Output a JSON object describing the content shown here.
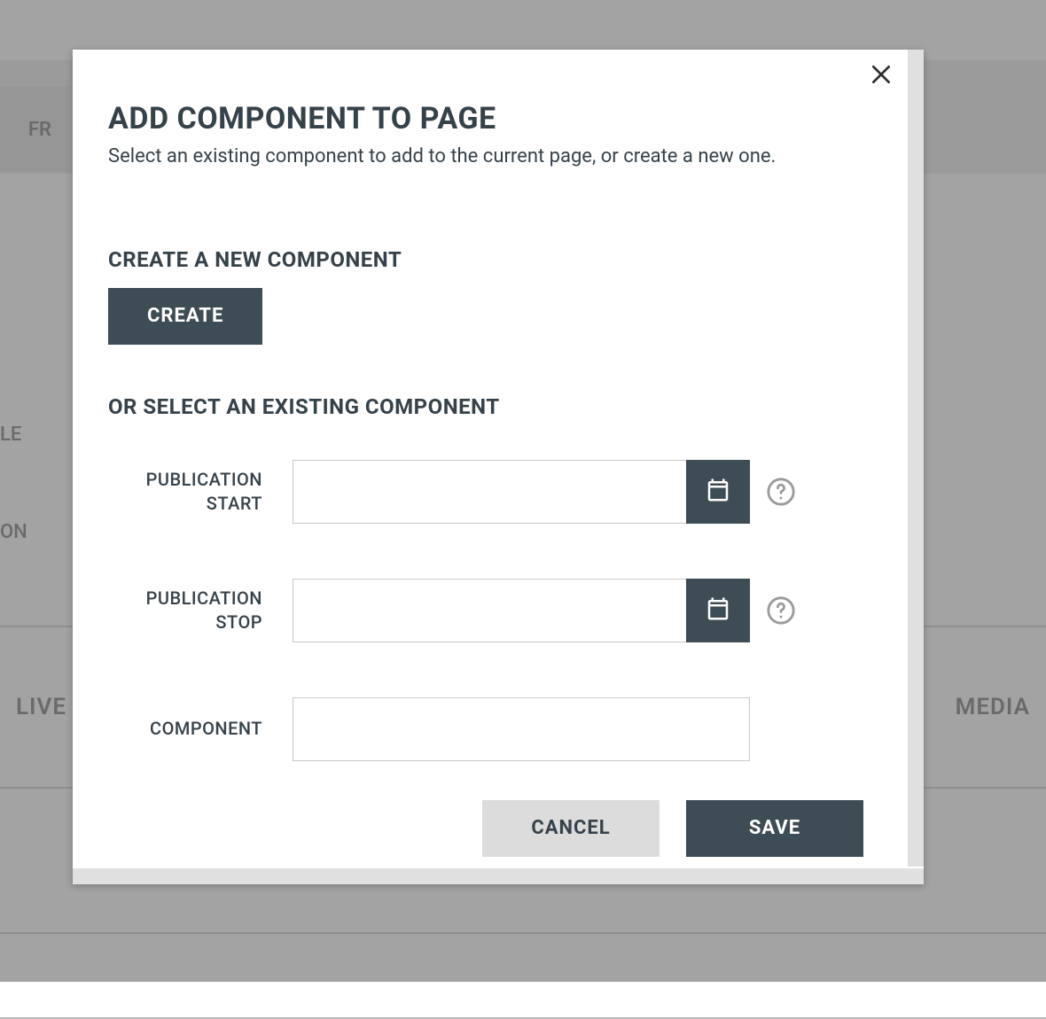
{
  "background": {
    "lang_tab": "FR",
    "side_label_1": "LE",
    "side_label_2": "ON",
    "tab_left": "LIVE",
    "tab_right": "MEDIA"
  },
  "dialog": {
    "title": "ADD COMPONENT TO PAGE",
    "subtitle": "Select an existing component to add to the current page, or create a new one.",
    "create_heading": "CREATE A NEW COMPONENT",
    "create_button": "CREATE",
    "select_heading": "OR SELECT AN EXISTING COMPONENT",
    "fields": {
      "pub_start_label": "PUBLICATION START",
      "pub_start_value": "",
      "pub_stop_label": "PUBLICATION STOP",
      "pub_stop_value": "",
      "component_label": "COMPONENT",
      "component_value": ""
    },
    "cancel_button": "CANCEL",
    "save_button": "SAVE"
  }
}
